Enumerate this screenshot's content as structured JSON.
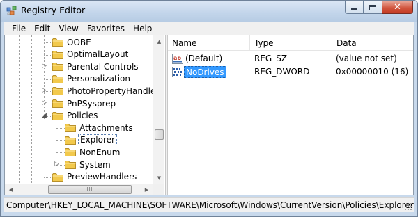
{
  "window": {
    "title": "Registry Editor",
    "close_glyph": "✕"
  },
  "menu": [
    "File",
    "Edit",
    "View",
    "Favorites",
    "Help"
  ],
  "tree": {
    "items": [
      {
        "label": "OOBE",
        "expander": "",
        "indent": 1,
        "selected": false
      },
      {
        "label": "OptimalLayout",
        "expander": "",
        "indent": 1,
        "selected": false
      },
      {
        "label": "Parental Controls",
        "expander": "▷",
        "indent": 1,
        "selected": false
      },
      {
        "label": "Personalization",
        "expander": "",
        "indent": 1,
        "selected": false
      },
      {
        "label": "PhotoPropertyHandler",
        "expander": "▷",
        "indent": 1,
        "selected": false
      },
      {
        "label": "PnPSysprep",
        "expander": "▷",
        "indent": 1,
        "selected": false
      },
      {
        "label": "Policies",
        "expander": "◢",
        "indent": 1,
        "selected": false
      },
      {
        "label": "Attachments",
        "expander": "",
        "indent": 2,
        "selected": false
      },
      {
        "label": "Explorer",
        "expander": "",
        "indent": 2,
        "selected": true
      },
      {
        "label": "NonEnum",
        "expander": "",
        "indent": 2,
        "selected": false
      },
      {
        "label": "System",
        "expander": "▷",
        "indent": 2,
        "selected": false
      },
      {
        "label": "PreviewHandlers",
        "expander": "",
        "indent": 1,
        "selected": false
      }
    ],
    "hscroll_grip": "III",
    "scroll_up": "▲",
    "scroll_down": "▼",
    "scroll_left": "◀",
    "scroll_right": "▶"
  },
  "list": {
    "columns": [
      "Name",
      "Type",
      "Data"
    ],
    "rows": [
      {
        "name": "(Default)",
        "type": "REG_SZ",
        "data": "(value not set)",
        "icon": "string-value-icon",
        "selected": false
      },
      {
        "name": "NoDrives",
        "type": "REG_DWORD",
        "data": "0x00000010 (16)",
        "icon": "binary-value-icon",
        "selected": true
      }
    ]
  },
  "status": {
    "path": "Computer\\HKEY_LOCAL_MACHINE\\SOFTWARE\\Microsoft\\Windows\\CurrentVersion\\Policies\\Explorer"
  },
  "colors": {
    "selection": "#3399ff",
    "folder": "#f2c94c",
    "close_button": "#c43b22"
  }
}
